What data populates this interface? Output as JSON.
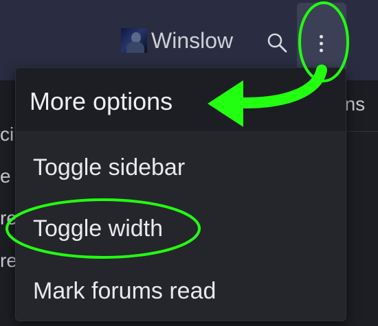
{
  "header": {
    "username": "Winslow",
    "icons": {
      "avatar": "user-avatar-photo",
      "search": "search-icon",
      "more": "vertical-ellipsis-icon"
    }
  },
  "background": {
    "right_fragment": "ons",
    "left_fragments": [
      "ci",
      "e",
      "re",
      "re"
    ]
  },
  "menu": {
    "title": "More options",
    "items": [
      {
        "label": "Toggle sidebar"
      },
      {
        "label": "Toggle width"
      },
      {
        "label": "Mark forums read"
      }
    ]
  },
  "colors": {
    "annotation": "#22ff11",
    "topbar": "#2a2d42",
    "menu_bg": "#25262c"
  }
}
